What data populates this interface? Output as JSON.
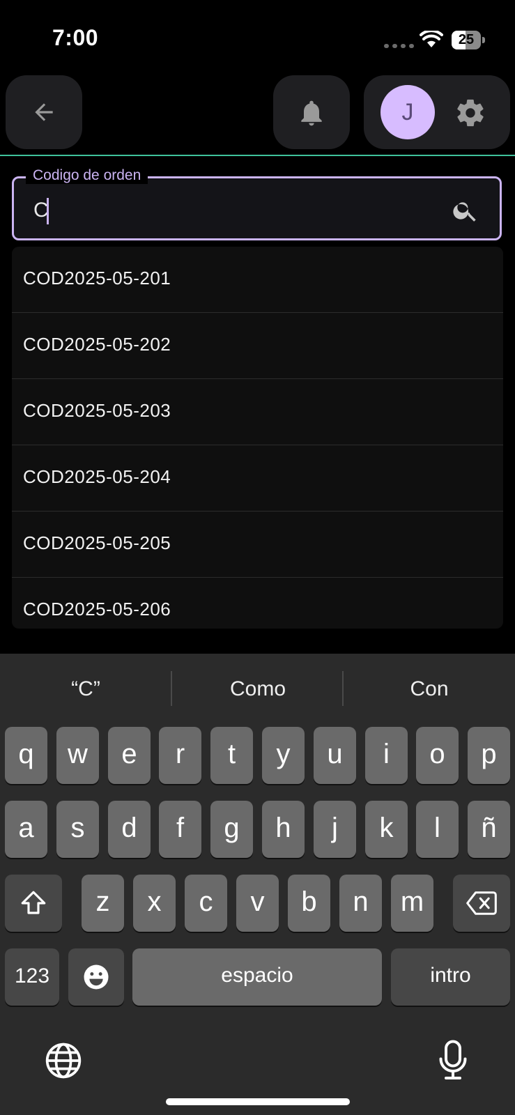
{
  "status_bar": {
    "time": "7:00",
    "battery": "25"
  },
  "colors": {
    "accent": "#cbb4f2",
    "divider": "#3fc29c",
    "avatar_bg": "#d7bcff"
  },
  "header": {
    "back_icon": "arrow-left-icon",
    "notifications_icon": "bell-icon",
    "avatar_initial": "J",
    "settings_icon": "gear-icon"
  },
  "search": {
    "label": "Codigo de orden",
    "value": "C",
    "icon": "search-icon"
  },
  "suggestions": [
    "COD2025-05-201",
    "COD2025-05-202",
    "COD2025-05-203",
    "COD2025-05-204",
    "COD2025-05-205",
    "COD2025-05-206"
  ],
  "keyboard": {
    "predictions": [
      "“C”",
      "Como",
      "Con"
    ],
    "row1": [
      "q",
      "w",
      "e",
      "r",
      "t",
      "y",
      "u",
      "i",
      "o",
      "p"
    ],
    "row2": [
      "a",
      "s",
      "d",
      "f",
      "g",
      "h",
      "j",
      "k",
      "l",
      "ñ"
    ],
    "row3": [
      "z",
      "x",
      "c",
      "v",
      "b",
      "n",
      "m"
    ],
    "numbers_key": "123",
    "space_key": "espacio",
    "return_key": "intro",
    "shift_icon": "shift-icon",
    "backspace_icon": "backspace-icon",
    "emoji_icon": "emoji-icon",
    "globe_icon": "globe-icon",
    "mic_icon": "microphone-icon"
  }
}
